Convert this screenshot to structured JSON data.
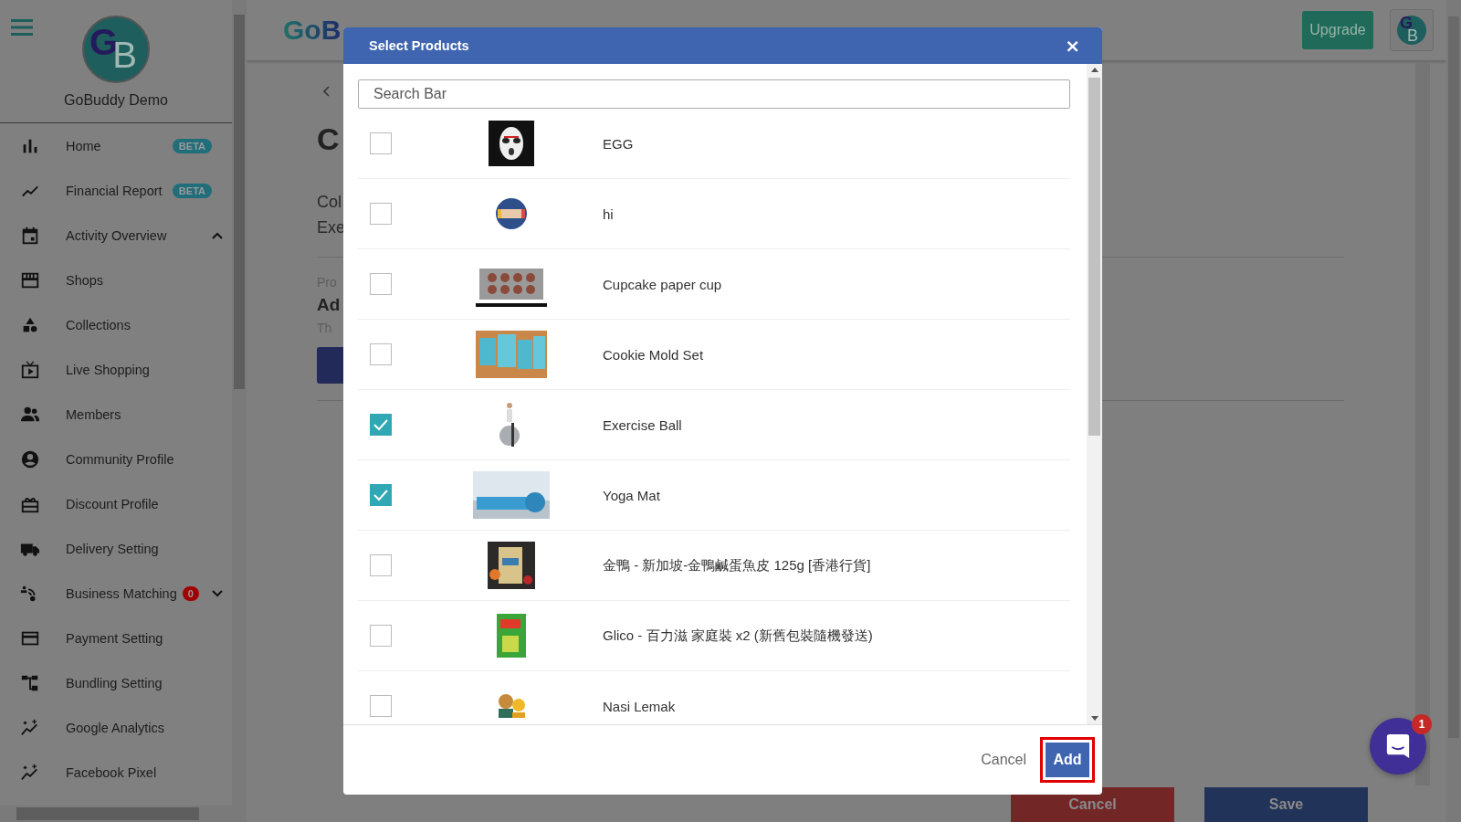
{
  "sidebar": {
    "avatar": [
      "G",
      "B"
    ],
    "brand": "GoBuddy Demo",
    "items": [
      {
        "label": "Home",
        "badge": {
          "text": "BETA",
          "kind": "beta"
        }
      },
      {
        "label": "Financial Report",
        "badge": {
          "text": "BETA",
          "kind": "beta"
        }
      },
      {
        "label": "Activity Overview",
        "expanded": true
      },
      {
        "label": "Shops"
      },
      {
        "label": "Collections"
      },
      {
        "label": "Live Shopping"
      },
      {
        "label": "Members"
      },
      {
        "label": "Community Profile"
      },
      {
        "label": "Discount Profile"
      },
      {
        "label": "Delivery Setting"
      },
      {
        "label": "Business Matching",
        "badge": {
          "text": "0",
          "kind": "count"
        },
        "expanded": false
      },
      {
        "label": "Payment Setting"
      },
      {
        "label": "Bundling Setting"
      },
      {
        "label": "Google Analytics"
      },
      {
        "label": "Facebook Pixel"
      }
    ]
  },
  "topbar": {
    "logo": "GoB",
    "upgrade": "Upgrade",
    "avatar": [
      "G",
      "B"
    ]
  },
  "page": {
    "title": "C",
    "lines": [
      "Col",
      "Exe"
    ],
    "section_label": "Pro",
    "section_title": "Ad",
    "section_text": "Th",
    "footer_buttons": [
      {
        "label": "Cancel",
        "kind": "danger"
      },
      {
        "label": "Save",
        "kind": "primary"
      }
    ]
  },
  "modal": {
    "title": "Select Products",
    "close": "×",
    "search": {
      "placeholder": "Search Bar"
    },
    "products": [
      {
        "name": "EGG",
        "checked": false
      },
      {
        "name": "hi",
        "checked": false
      },
      {
        "name": "Cupcake paper cup",
        "checked": false
      },
      {
        "name": "Cookie Mold Set",
        "checked": false
      },
      {
        "name": "Exercise Ball",
        "checked": true
      },
      {
        "name": "Yoga Mat",
        "checked": true
      },
      {
        "name": "金鴨 - 新加坡-金鴨鹹蛋魚皮 125g [香港行貨]",
        "checked": false
      },
      {
        "name": "Glico - 百力滋 家庭裝 x2 (新舊包裝隨機發送)",
        "checked": false
      },
      {
        "name": "Nasi Lemak",
        "checked": false
      }
    ],
    "buttons": [
      {
        "label": "Cancel",
        "kind": "text",
        "highlighted": false
      },
      {
        "label": "Add",
        "kind": "primary",
        "highlighted": true
      }
    ]
  },
  "chat": {
    "badge": "1"
  }
}
